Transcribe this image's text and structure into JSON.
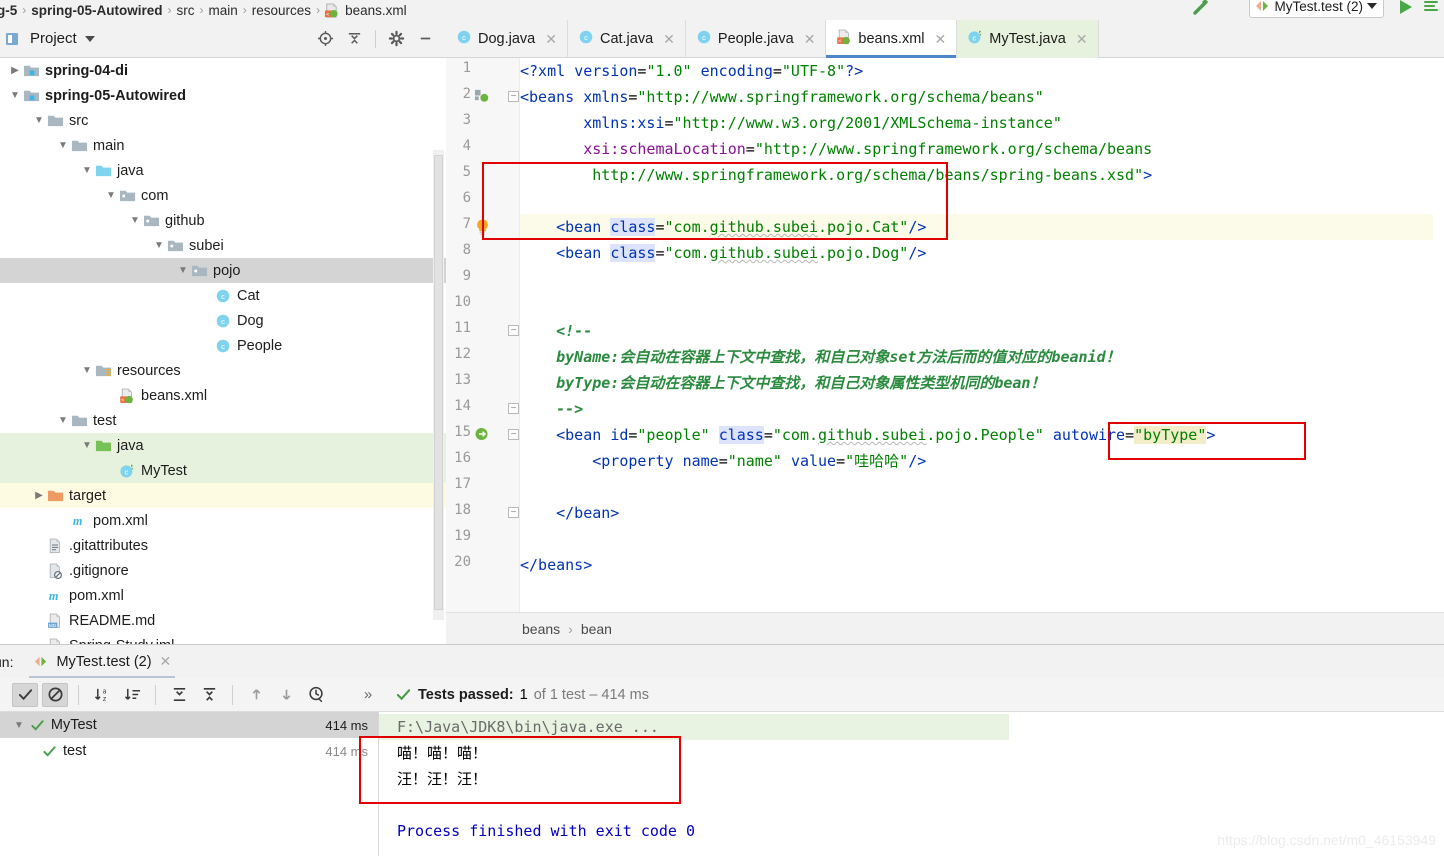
{
  "window": {
    "top_breadcrumb": [
      {
        "text": "g-5",
        "bold": true
      },
      {
        "text": "spring-05-Autowired",
        "bold": true
      },
      {
        "text": "src",
        "bold": false
      },
      {
        "text": "main",
        "bold": false
      },
      {
        "text": "resources",
        "bold": false
      },
      {
        "text": "beans.xml",
        "bold": false
      }
    ],
    "run_config": "MyTest.test (2)"
  },
  "project_panel": {
    "title": "Project",
    "tools": [
      "locate-icon",
      "collapse-all-icon",
      "settings-gear-icon",
      "minimize-icon"
    ],
    "tree": [
      {
        "label": "spring-04-di",
        "indent": 0,
        "arrow": "right",
        "icon": "module-folder",
        "bold": true,
        "state": "none"
      },
      {
        "label": "spring-05-Autowired",
        "indent": 0,
        "arrow": "down",
        "icon": "module-folder",
        "bold": true,
        "state": "none"
      },
      {
        "label": "src",
        "indent": 1,
        "arrow": "down",
        "icon": "folder",
        "bold": false,
        "state": "none"
      },
      {
        "label": "main",
        "indent": 2,
        "arrow": "down",
        "icon": "folder",
        "bold": false,
        "state": "none"
      },
      {
        "label": "java",
        "indent": 3,
        "arrow": "down",
        "icon": "source-folder",
        "bold": false,
        "state": "none"
      },
      {
        "label": "com",
        "indent": 4,
        "arrow": "down",
        "icon": "package",
        "bold": false,
        "state": "none"
      },
      {
        "label": "github",
        "indent": 5,
        "arrow": "down",
        "icon": "package",
        "bold": false,
        "state": "none"
      },
      {
        "label": "subei",
        "indent": 6,
        "arrow": "down",
        "icon": "package",
        "bold": false,
        "state": "none"
      },
      {
        "label": "pojo",
        "indent": 7,
        "arrow": "down",
        "icon": "package",
        "bold": false,
        "state": "selected"
      },
      {
        "label": "Cat",
        "indent": 8,
        "arrow": "none",
        "icon": "java-class",
        "bold": false,
        "state": "none"
      },
      {
        "label": "Dog",
        "indent": 8,
        "arrow": "none",
        "icon": "java-class",
        "bold": false,
        "state": "none"
      },
      {
        "label": "People",
        "indent": 8,
        "arrow": "none",
        "icon": "java-class",
        "bold": false,
        "state": "none"
      },
      {
        "label": "resources",
        "indent": 3,
        "arrow": "down",
        "icon": "resource-folder",
        "bold": false,
        "state": "none"
      },
      {
        "label": "beans.xml",
        "indent": 4,
        "arrow": "none",
        "icon": "spring-xml",
        "bold": false,
        "state": "none"
      },
      {
        "label": "test",
        "indent": 2,
        "arrow": "down",
        "icon": "folder",
        "bold": false,
        "state": "none"
      },
      {
        "label": "java",
        "indent": 3,
        "arrow": "down",
        "icon": "test-folder",
        "bold": false,
        "state": "green"
      },
      {
        "label": "MyTest",
        "indent": 4,
        "arrow": "none",
        "icon": "test-class",
        "bold": false,
        "state": "green"
      },
      {
        "label": "target",
        "indent": 1,
        "arrow": "right",
        "icon": "excluded-folder",
        "bold": false,
        "state": "yellow"
      },
      {
        "label": "pom.xml",
        "indent": 2,
        "arrow": "none",
        "icon": "maven",
        "bold": false,
        "state": "none"
      },
      {
        "label": ".gitattributes",
        "indent": 1,
        "arrow": "none",
        "icon": "text-file",
        "bold": false,
        "state": "none"
      },
      {
        "label": ".gitignore",
        "indent": 1,
        "arrow": "none",
        "icon": "ignore-file",
        "bold": false,
        "state": "none"
      },
      {
        "label": "pom.xml",
        "indent": 1,
        "arrow": "none",
        "icon": "maven",
        "bold": false,
        "state": "none"
      },
      {
        "label": "README.md",
        "indent": 1,
        "arrow": "none",
        "icon": "markdown-file",
        "bold": false,
        "state": "none"
      },
      {
        "label": "Spring-Study.iml",
        "indent": 1,
        "arrow": "none",
        "icon": "iml-file",
        "bold": false,
        "state": "none"
      }
    ]
  },
  "editor_tabs": [
    {
      "label": "Dog.java",
      "icon": "java-class",
      "active": false,
      "tint": "none"
    },
    {
      "label": "Cat.java",
      "icon": "java-class",
      "active": false,
      "tint": "none"
    },
    {
      "label": "People.java",
      "icon": "java-class",
      "active": false,
      "tint": "none"
    },
    {
      "label": "beans.xml",
      "icon": "spring-xml",
      "active": true,
      "tint": "none"
    },
    {
      "label": "MyTest.java",
      "icon": "test-class",
      "active": false,
      "tint": "green"
    }
  ],
  "editor": {
    "line_numbers": [
      "1",
      "2",
      "3",
      "4",
      "5",
      "6",
      "7",
      "8",
      "9",
      "10",
      "11",
      "12",
      "13",
      "14",
      "15",
      "16",
      "17",
      "18",
      "19",
      "20"
    ],
    "gutter_icons": [
      {
        "line": 2,
        "icon": "spring-bean-config-icon"
      },
      {
        "line": 7,
        "icon": "intention-bulb-icon"
      },
      {
        "line": 15,
        "icon": "spring-navigate-icon"
      }
    ],
    "fold_marks": [
      2,
      11,
      14,
      15,
      18
    ],
    "highlighted_line": 7,
    "lines": [
      {
        "n": 1,
        "text": "<?xml version=\"1.0\" encoding=\"UTF-8\"?>"
      },
      {
        "n": 2,
        "text": "<beans xmlns=\"http://www.springframework.org/schema/beans\""
      },
      {
        "n": 3,
        "text": "       xmlns:xsi=\"http://www.w3.org/2001/XMLSchema-instance\""
      },
      {
        "n": 4,
        "text": "       xsi:schemaLocation=\"http://www.springframework.org/schema/beans"
      },
      {
        "n": 5,
        "text": "        http://www.springframework.org/schema/beans/spring-beans.xsd\">"
      },
      {
        "n": 6,
        "text": ""
      },
      {
        "n": 7,
        "text": "    <bean class=\"com.github.subei.pojo.Cat\"/>"
      },
      {
        "n": 8,
        "text": "    <bean class=\"com.github.subei.pojo.Dog\"/>"
      },
      {
        "n": 9,
        "text": ""
      },
      {
        "n": 10,
        "text": ""
      },
      {
        "n": 11,
        "text": "    <!--"
      },
      {
        "n": 12,
        "text": "    byName:会自动在容器上下文中查找，和自己对象set方法后而的值对应的beanid！"
      },
      {
        "n": 13,
        "text": "    byType:会自动在容器上下文中查找，和自己对象属性类型机同的bean！"
      },
      {
        "n": 14,
        "text": "    -->"
      },
      {
        "n": 15,
        "text": "    <bean id=\"people\" class=\"com.github.subei.pojo.People\" autowire=\"byType\">"
      },
      {
        "n": 16,
        "text": "        <property name=\"name\" value=\"哇哈哈\"/>"
      },
      {
        "n": 17,
        "text": ""
      },
      {
        "n": 18,
        "text": "    </bean>"
      },
      {
        "n": 19,
        "text": ""
      },
      {
        "n": 20,
        "text": "</beans>"
      }
    ],
    "breadcrumb": [
      "beans",
      "bean"
    ]
  },
  "run_window": {
    "prefix_label": "un:",
    "tab_label": "MyTest.test (2)",
    "toolbar_icons": [
      "show-passed-icon",
      "hide-ignored-icon",
      "sort-alphabetically-icon",
      "sort-by-duration-icon",
      "expand-all-icon",
      "collapse-all-icon",
      "prev-failed-icon",
      "next-failed-icon",
      "history-icon",
      "more-icon"
    ],
    "status": {
      "prefix": "Tests passed:",
      "count": "1",
      "detail": "of 1 test – 414 ms"
    },
    "tests": [
      {
        "label": "MyTest",
        "duration": "414 ms",
        "state": "passed",
        "selected": true,
        "arrow": "down",
        "indent": 0
      },
      {
        "label": "test",
        "duration": "414 ms",
        "state": "passed",
        "selected": false,
        "arrow": "none",
        "indent": 1
      }
    ],
    "console": [
      {
        "text": "F:\\Java\\JDK8\\bin\\java.exe ...",
        "style": "cmd"
      },
      {
        "text": "喵！喵！喵！",
        "style": "out"
      },
      {
        "text": "汪！汪！汪！",
        "style": "out"
      },
      {
        "text": "",
        "style": "out"
      },
      {
        "text": "Process finished with exit code 0",
        "style": "fin"
      }
    ]
  },
  "watermark": "https://blog.csdn.net/m0_46153949",
  "colors": {
    "accent_blue": "#4a86c8",
    "tag": "#0033b3",
    "value": "#008000",
    "namespace": "#871094",
    "comment": "#2a8a3e",
    "attr_highlight": "#dde3fb",
    "value_highlight": "#f2edc8",
    "annotation_red": "#e00000",
    "selection_gray": "#d4d4d4",
    "green_tint": "#e6f2de",
    "yellow_tint": "#fdfbe2"
  }
}
